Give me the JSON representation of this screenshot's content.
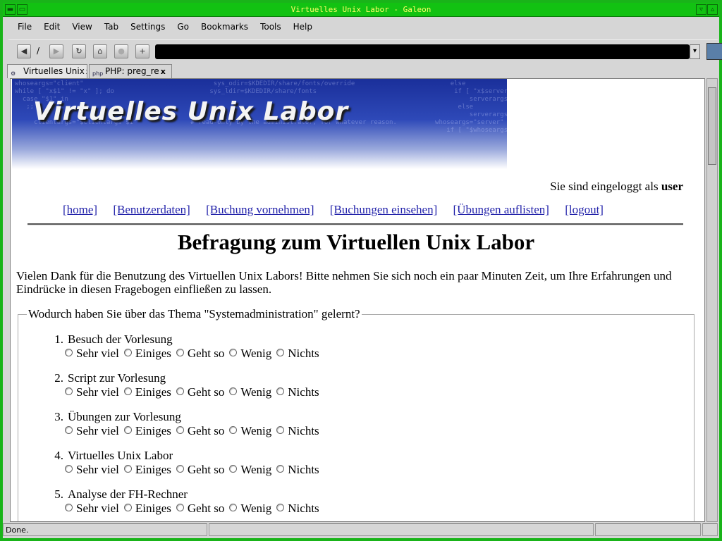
{
  "window": {
    "title": "Virtuelles Unix Labor - Galeon"
  },
  "menubar": [
    {
      "label": "File",
      "accel": "F"
    },
    {
      "label": "Edit",
      "accel": "E"
    },
    {
      "label": "View",
      "accel": "V"
    },
    {
      "label": "Tab",
      "accel": "T"
    },
    {
      "label": "Settings",
      "accel": "S"
    },
    {
      "label": "Go",
      "accel": "G"
    },
    {
      "label": "Bookmarks",
      "accel": "B"
    },
    {
      "label": "Tools",
      "accel": "T"
    },
    {
      "label": "Help",
      "accel": "H"
    }
  ],
  "toolbar": {
    "back_icon": "back-arrow-icon",
    "forward_icon": "forward-arrow-icon",
    "reload_icon": "reload-icon",
    "home_icon": "home-icon",
    "stop_icon": "stop-icon",
    "new_tab_icon": "new-tab-icon",
    "address_value": ""
  },
  "tabs": [
    {
      "label": "Virtuelles Unix",
      "icon": "galeon-icon",
      "active": true
    },
    {
      "label": "PHP: preg_re",
      "icon": "php-icon",
      "active": false
    }
  ],
  "page": {
    "banner_title": "Virtuelles Unix Labor",
    "logged_in_prefix": "Sie sind eingeloggt als",
    "logged_in_user": "user",
    "nav": [
      "[home]",
      "[Benutzerdaten]",
      "[Buchung vornehmen]",
      "[Buchungen einsehen]",
      "[Übungen auflisten]",
      "[logout]"
    ],
    "heading": "Befragung zum Virtuellen Unix Labor",
    "intro": "Vielen Dank für die Benutzung des Virtuellen Unix Labors! Bitte nehmen Sie sich noch ein paar Minuten Zeit, um Ihre Erfahrungen und Eindrücke in diesen Fragebogen einfließen zu lassen.",
    "fieldset_legend": "Wodurch haben Sie über das Thema \"Systemadministration\" gelernt?",
    "questions": [
      {
        "num": "1.",
        "label": "Besuch der Vorlesung"
      },
      {
        "num": "2.",
        "label": "Script zur Vorlesung"
      },
      {
        "num": "3.",
        "label": "Übungen zur Vorlesung"
      },
      {
        "num": "4.",
        "label": "Virtuelles Unix Labor"
      },
      {
        "num": "5.",
        "label": "Analyse der FH-Rechner"
      }
    ],
    "options": [
      "Sehr viel",
      "Einiges",
      "Geht so",
      "Wenig",
      "Nichts"
    ]
  },
  "statusbar": {
    "text": "Done."
  },
  "colors": {
    "titlebar": "#12c212",
    "title_text": "#ffff66",
    "link": "#2222aa",
    "banner_top": "#1a2f9a"
  }
}
